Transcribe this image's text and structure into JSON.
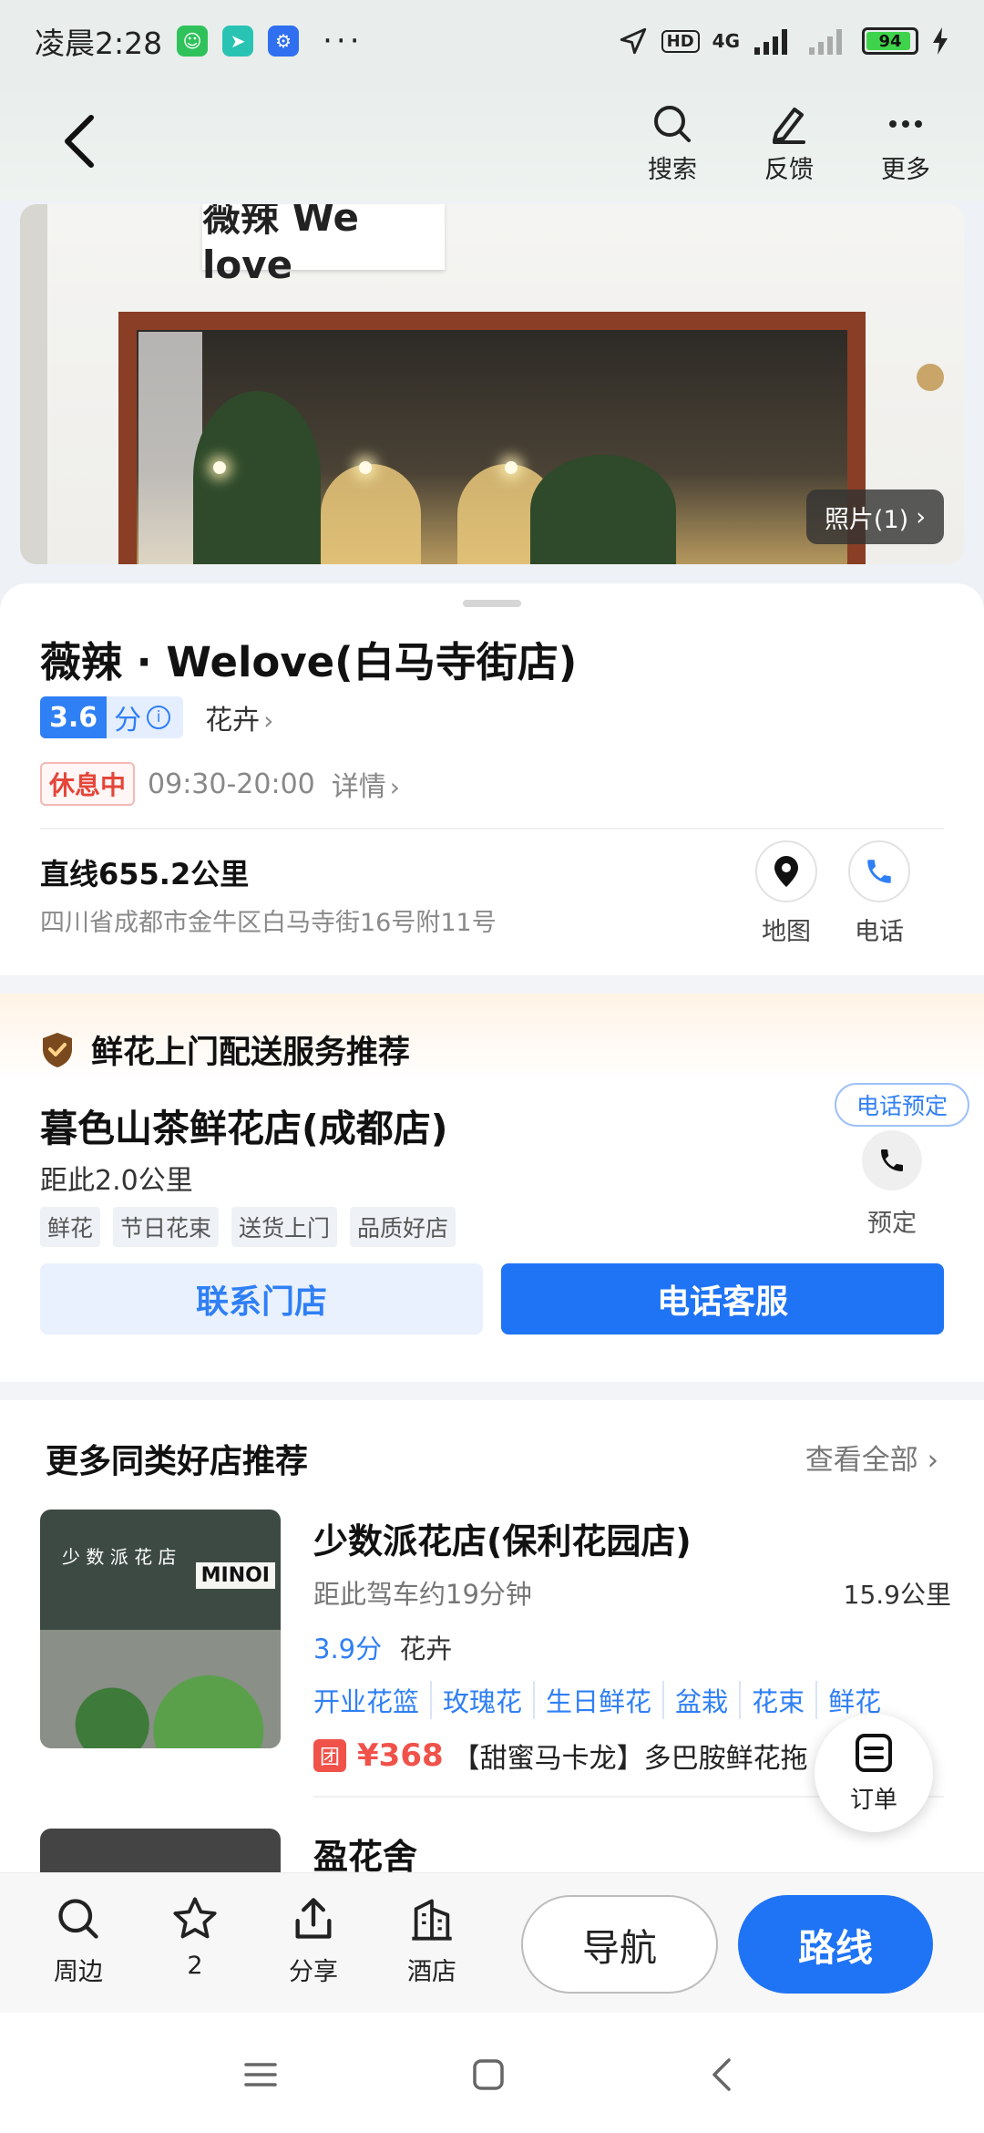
{
  "status_bar": {
    "time": "凌晨2:28",
    "more": "···",
    "hd": "HD",
    "network": "4G",
    "battery": "94"
  },
  "header": {
    "actions": [
      {
        "label": "搜索",
        "icon": "search-icon"
      },
      {
        "label": "反馈",
        "icon": "pen-icon"
      },
      {
        "label": "更多",
        "icon": "more-icon"
      }
    ]
  },
  "photo": {
    "sign_text": "薇辣 We love",
    "badge": "照片(1)"
  },
  "place": {
    "name": "薇辣 · Welove(白马寺街店)",
    "rating": "3.6",
    "rating_unit": "分",
    "category": "花卉",
    "status": "休息中",
    "hours": "09:30-20:00",
    "details": "详情",
    "distance": "直线655.2公里",
    "address": "四川省成都市金牛区白马寺街16号附11号",
    "map_label": "地图",
    "phone_label": "电话"
  },
  "promo": {
    "heading": "鲜花上门配送服务推荐",
    "shop_name": "暮色山茶鲜花店(成都店)",
    "distance": "距此2.0公里",
    "tags": [
      "鲜花",
      "节日花束",
      "送货上门",
      "品质好店"
    ],
    "reserve_bubble": "电话预定",
    "reserve_label": "预定",
    "contact_button": "联系门店",
    "call_button": "电话客服"
  },
  "recommendations": {
    "title": "更多同类好店推荐",
    "view_all": "查看全部",
    "items": [
      {
        "name": "少数派花店(保利花园店)",
        "drive": "距此驾车约19分钟",
        "km": "15.9公里",
        "rating": "3.9",
        "rating_unit": "分",
        "category": "花卉",
        "tags": [
          "开业花篮",
          "玫瑰花",
          "生日鲜花",
          "盆栽",
          "花束",
          "鲜花"
        ],
        "deal_icon": "团",
        "deal_price": "¥368",
        "deal_text": "【甜蜜马卡龙】多巴胺鲜花拖",
        "thumb_sign": "少 数 派 花 店",
        "thumb_sign2": "MINOI"
      },
      {
        "name": "盈花舍"
      }
    ]
  },
  "fab": {
    "label": "订单"
  },
  "toolbar": {
    "items": [
      {
        "label": "周边",
        "icon": "search-icon"
      },
      {
        "label": "2",
        "icon": "star-icon"
      },
      {
        "label": "分享",
        "icon": "share-icon"
      },
      {
        "label": "酒店",
        "icon": "hotel-icon"
      }
    ],
    "navigate": "导航",
    "route": "路线"
  },
  "colors": {
    "accent": "#1f73f5",
    "closed_red": "#e5453a",
    "deal_red": "#f0524a"
  }
}
